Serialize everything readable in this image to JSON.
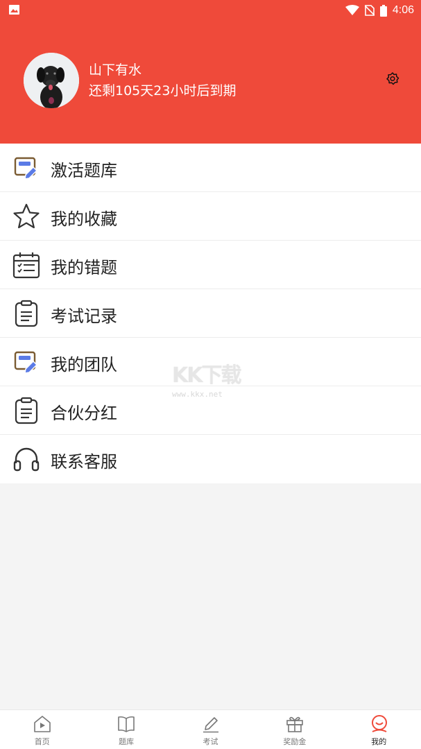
{
  "status_bar": {
    "time": "4:06"
  },
  "profile": {
    "username": "山下有水",
    "expiry": "还剩105天23小时后到期"
  },
  "menu": [
    {
      "label": "激活题库",
      "icon": "activate-icon"
    },
    {
      "label": "我的收藏",
      "icon": "star-icon"
    },
    {
      "label": "我的错题",
      "icon": "calendar-checklist-icon"
    },
    {
      "label": "考试记录",
      "icon": "clipboard-icon"
    },
    {
      "label": "我的团队",
      "icon": "activate-icon"
    },
    {
      "label": "合伙分红",
      "icon": "clipboard-icon"
    },
    {
      "label": "联系客服",
      "icon": "headset-icon"
    }
  ],
  "watermark": {
    "logo": "KK下载",
    "url": "www.kkx.net"
  },
  "tabs": [
    {
      "label": "首页",
      "icon": "home-play-icon"
    },
    {
      "label": "题库",
      "icon": "book-icon"
    },
    {
      "label": "考试",
      "icon": "pencil-icon"
    },
    {
      "label": "奖励金",
      "icon": "gift-icon"
    },
    {
      "label": "我的",
      "icon": "profile-icon",
      "active": true
    }
  ],
  "colors": {
    "brand_red": "#ef4a3a",
    "icon_blue": "#5b7be6",
    "icon_brown": "#7a5b32"
  }
}
